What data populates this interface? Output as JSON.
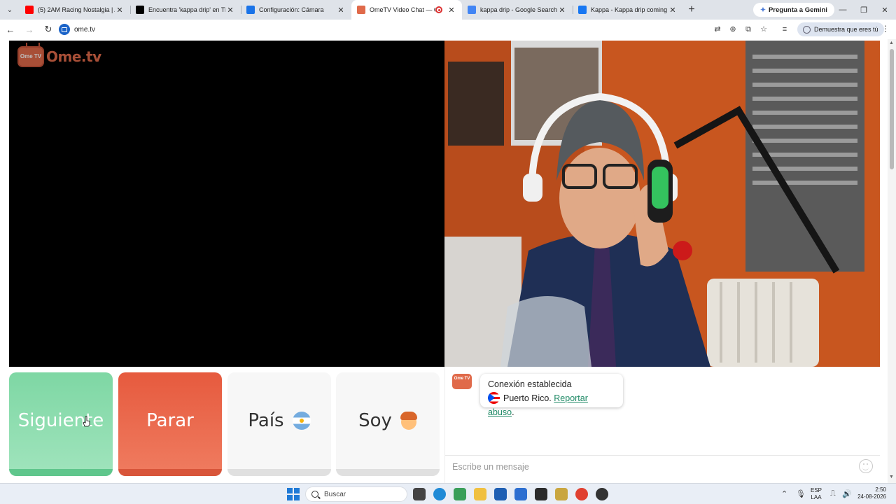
{
  "browser": {
    "tabs": [
      {
        "title": "(5) 2AM Racing Nostalgia | Atm",
        "favicon": "youtube-icon",
        "color": "#ff0000",
        "active": false
      },
      {
        "title": "Encuentra 'kappa drip' en TikTo",
        "favicon": "tiktok-icon",
        "color": "#000000",
        "active": false
      },
      {
        "title": "Configuración: Cámara",
        "favicon": "gear-icon",
        "color": "#1a73e8",
        "active": false
      },
      {
        "title": "OmeTV Video Chat — Ome",
        "favicon": "ometv-icon",
        "color": "#e06a4a",
        "active": true,
        "recording": true
      },
      {
        "title": "kappa drip - Google Search",
        "favicon": "google-icon",
        "color": "#4285f4",
        "active": false
      },
      {
        "title": "Kappa - Kappa drip coming al",
        "favicon": "facebook-icon",
        "color": "#1877f2",
        "active": false
      }
    ],
    "gemini_label": "Pregunta a Gemini",
    "address": "ome.tv",
    "profile_label": "Demuestra que eres tú"
  },
  "app": {
    "logo_text": "Ome.tv",
    "logo_badge": "Ome TV",
    "buttons": {
      "next": "Siguiente",
      "stop": "Parar",
      "country": "País",
      "gender": "Soy"
    },
    "chat": {
      "status": "Conexión establecida",
      "country": "Puerto Rico.",
      "report": "Reportar abuso",
      "report_suffix": ".",
      "input_placeholder": "Escribe un mensaje"
    }
  },
  "taskbar": {
    "search_label": "Buscar",
    "lang_top": "ESP",
    "lang_bottom": "LAA",
    "time": "2:50",
    "date": "24-08-2026"
  }
}
